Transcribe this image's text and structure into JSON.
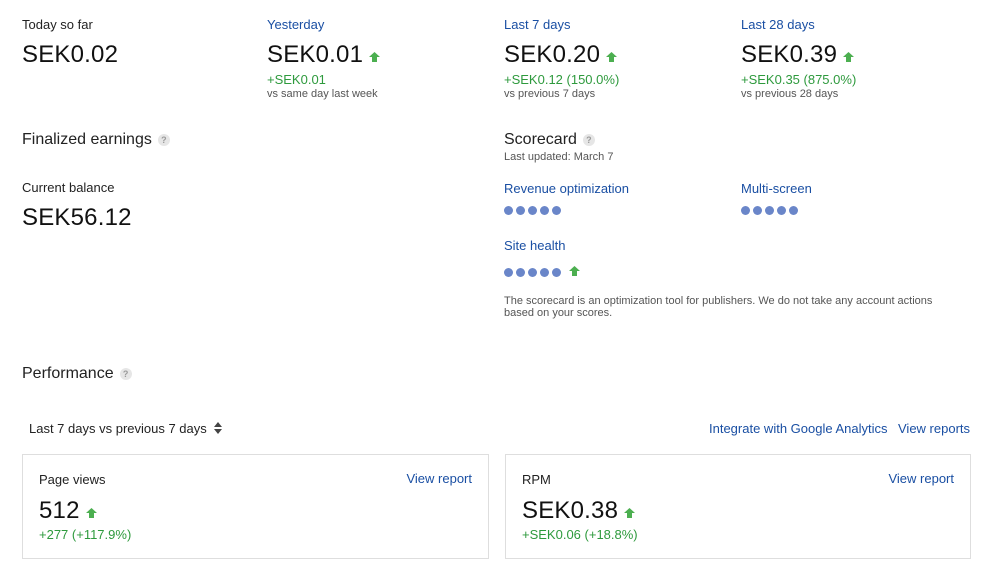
{
  "overview": {
    "today": {
      "label": "Today so far",
      "value": "SEK0.02"
    },
    "yesterday": {
      "label": "Yesterday",
      "value": "SEK0.01",
      "change": "+SEK0.01",
      "compare": "vs same day last week"
    },
    "last7": {
      "label": "Last 7 days",
      "value": "SEK0.20",
      "change": "+SEK0.12 (150.0%)",
      "compare": "vs previous 7 days"
    },
    "last28": {
      "label": "Last 28 days",
      "value": "SEK0.39",
      "change": "+SEK0.35 (875.0%)",
      "compare": "vs previous 28 days"
    }
  },
  "finalized": {
    "title": "Finalized earnings",
    "balance_label": "Current balance",
    "balance_value": "SEK56.12"
  },
  "scorecard": {
    "title": "Scorecard",
    "updated": "Last updated: March 7",
    "revenue_label": "Revenue optimization",
    "revenue_score": 5,
    "multiscreen_label": "Multi-screen",
    "multiscreen_score": 5,
    "site_health_label": "Site health",
    "site_health_score": 5,
    "note": "The scorecard is an optimization tool for publishers. We do not take any account actions based on your scores."
  },
  "performance": {
    "title": "Performance",
    "range": "Last 7 days vs previous 7 days",
    "integrate_link": "Integrate with Google Analytics",
    "view_reports_link": "View reports",
    "cards": [
      {
        "title": "Page views",
        "link": "View report",
        "value": "512",
        "change": "+277 (+117.9%)"
      },
      {
        "title": "RPM",
        "link": "View report",
        "value": "SEK0.38",
        "change": "+SEK0.06 (+18.8%)"
      }
    ]
  },
  "colors": {
    "link": "#1a4fa3",
    "positive": "#2e9a3d",
    "dot": "#6a86c9"
  },
  "icons": {
    "trend": "up-arrow-icon",
    "help": "question-icon",
    "sort": "sort-arrows-icon"
  }
}
